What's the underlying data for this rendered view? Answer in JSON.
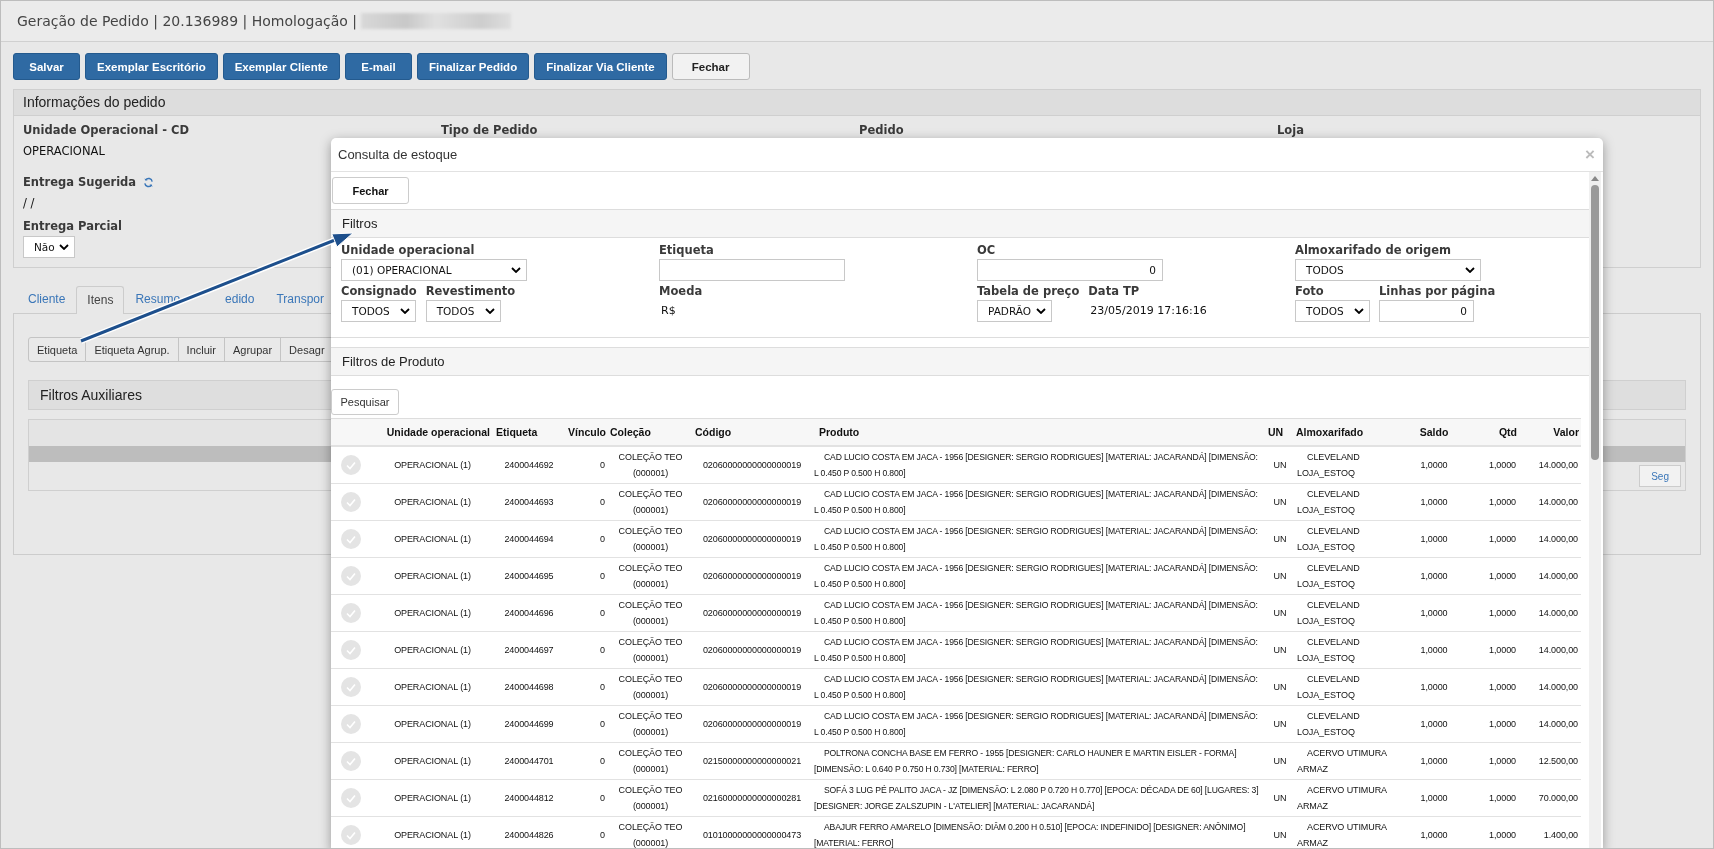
{
  "window": {
    "title": "Geração de Pedido | 20.136989 | Homologação |"
  },
  "toolbar": [
    {
      "label": "Salvar",
      "kind": "primary"
    },
    {
      "label": "Exemplar Escritório",
      "kind": "primary"
    },
    {
      "label": "Exemplar Cliente",
      "kind": "primary"
    },
    {
      "label": "E-mail",
      "kind": "primary"
    },
    {
      "label": "Finalizar Pedido",
      "kind": "primary"
    },
    {
      "label": "Finalizar Via Cliente",
      "kind": "primary"
    },
    {
      "label": "Fechar",
      "kind": "default"
    }
  ],
  "order_info": {
    "title": "Informações do pedido",
    "columns": [
      {
        "fields": [
          {
            "label": "Unidade Operacional - CD",
            "kind": "text",
            "value": "OPERACIONAL"
          },
          {
            "label": "Entrega Sugerida",
            "kind": "refresh",
            "value": "/ /"
          },
          {
            "label": "Entrega Parcial",
            "kind": "select",
            "value": "Não"
          }
        ]
      },
      {
        "fields": [
          {
            "label": "Tipo de Pedido",
            "kind": "label"
          }
        ]
      },
      {
        "fields": [
          {
            "label": "Pedido",
            "kind": "label"
          }
        ]
      },
      {
        "fields": [
          {
            "label": "Loja",
            "kind": "label"
          }
        ]
      }
    ]
  },
  "tabs": [
    {
      "label": "Cliente",
      "selected": false
    },
    {
      "label": "Itens",
      "selected": true
    },
    {
      "parts": [
        "Resumo",
        "edido"
      ],
      "selected": false
    },
    {
      "label": "Transpor",
      "selected": false
    }
  ],
  "item_actions": [
    "Etiqueta",
    "Etiqueta Agrup.",
    "Incluir",
    "Agrupar",
    "Desagr"
  ],
  "aux_filters": {
    "title": "Filtros Auxiliares"
  },
  "grid": {
    "next_button": "Seg"
  },
  "modal": {
    "title": "Consulta de estoque",
    "close": "×",
    "close_button": "Fechar",
    "filters_title": "Filtros",
    "filter_columns": [
      [
        [
          {
            "label": "Unidade operacional",
            "kind": "select",
            "value": "(01) OPERACIONAL"
          }
        ],
        [
          {
            "label": "Consignado",
            "kind": "select",
            "value": "TODOS"
          },
          {
            "label": "Revestimento",
            "kind": "select",
            "value": "TODOS"
          }
        ]
      ],
      [
        [
          {
            "label": "Etiqueta",
            "kind": "input"
          }
        ],
        [
          {
            "label": "Moeda",
            "kind": "text",
            "value": "R$"
          }
        ]
      ],
      [
        [
          {
            "label": "OC",
            "kind": "input",
            "value": "0"
          }
        ],
        [
          {
            "label": "Tabela de preço",
            "kind": "select",
            "value": "PADRÃO"
          },
          {
            "label": "Data TP",
            "kind": "text",
            "value": "23/05/2019 17:16:16"
          }
        ]
      ],
      [
        [
          {
            "label": "Almoxarifado de origem",
            "kind": "select",
            "value": "TODOS"
          }
        ],
        [
          {
            "label": "Foto",
            "kind": "select",
            "value": "TODOS"
          },
          {
            "label": "Linhas por página",
            "kind": "input",
            "value": "0"
          }
        ]
      ]
    ],
    "product_filters_title": "Filtros de Produto",
    "search_button": "Pesquisar",
    "columns": [
      "Unidade operacional",
      "Etiqueta",
      "Vínculo",
      "Coleção",
      "Código",
      "Produto",
      "UN",
      "Almoxarifado",
      "Saldo",
      "Qtd",
      "Valor"
    ],
    "rows": [
      {
        "selected": false,
        "cells": [
          "OPERACIONAL (1)",
          "2400044692",
          "0",
          "COLEÇÃO TEO (000001)",
          "02060000000000000019",
          "CAD LUCIO COSTA EM JACA - 1956 [DESIGNER: SERGIO RODRIGUES] [MATERIAL: JACARANDÁ] [DIMENSÃO: L 0.450 P 0.500 H 0.800]",
          "UN",
          "CLEVELAND LOJA_ESTOQ",
          "1,0000",
          "1,0000",
          "14.000,00"
        ]
      },
      {
        "selected": false,
        "cells": [
          "OPERACIONAL (1)",
          "2400044693",
          "0",
          "COLEÇÃO TEO (000001)",
          "02060000000000000019",
          "CAD LUCIO COSTA EM JACA - 1956 [DESIGNER: SERGIO RODRIGUES] [MATERIAL: JACARANDÁ] [DIMENSÃO: L 0.450 P 0.500 H 0.800]",
          "UN",
          "CLEVELAND LOJA_ESTOQ",
          "1,0000",
          "1,0000",
          "14.000,00"
        ]
      },
      {
        "selected": false,
        "cells": [
          "OPERACIONAL (1)",
          "2400044694",
          "0",
          "COLEÇÃO TEO (000001)",
          "02060000000000000019",
          "CAD LUCIO COSTA EM JACA - 1956 [DESIGNER: SERGIO RODRIGUES] [MATERIAL: JACARANDÁ] [DIMENSÃO: L 0.450 P 0.500 H 0.800]",
          "UN",
          "CLEVELAND LOJA_ESTOQ",
          "1,0000",
          "1,0000",
          "14.000,00"
        ]
      },
      {
        "selected": false,
        "cells": [
          "OPERACIONAL (1)",
          "2400044695",
          "0",
          "COLEÇÃO TEO (000001)",
          "02060000000000000019",
          "CAD LUCIO COSTA EM JACA - 1956 [DESIGNER: SERGIO RODRIGUES] [MATERIAL: JACARANDÁ] [DIMENSÃO: L 0.450 P 0.500 H 0.800]",
          "UN",
          "CLEVELAND LOJA_ESTOQ",
          "1,0000",
          "1,0000",
          "14.000,00"
        ]
      },
      {
        "selected": false,
        "cells": [
          "OPERACIONAL (1)",
          "2400044696",
          "0",
          "COLEÇÃO TEO (000001)",
          "02060000000000000019",
          "CAD LUCIO COSTA EM JACA - 1956 [DESIGNER: SERGIO RODRIGUES] [MATERIAL: JACARANDÁ] [DIMENSÃO: L 0.450 P 0.500 H 0.800]",
          "UN",
          "CLEVELAND LOJA_ESTOQ",
          "1,0000",
          "1,0000",
          "14.000,00"
        ]
      },
      {
        "selected": false,
        "cells": [
          "OPERACIONAL (1)",
          "2400044697",
          "0",
          "COLEÇÃO TEO (000001)",
          "02060000000000000019",
          "CAD LUCIO COSTA EM JACA - 1956 [DESIGNER: SERGIO RODRIGUES] [MATERIAL: JACARANDÁ] [DIMENSÃO: L 0.450 P 0.500 H 0.800]",
          "UN",
          "CLEVELAND LOJA_ESTOQ",
          "1,0000",
          "1,0000",
          "14.000,00"
        ]
      },
      {
        "selected": false,
        "cells": [
          "OPERACIONAL (1)",
          "2400044698",
          "0",
          "COLEÇÃO TEO (000001)",
          "02060000000000000019",
          "CAD LUCIO COSTA EM JACA - 1956 [DESIGNER: SERGIO RODRIGUES] [MATERIAL: JACARANDÁ] [DIMENSÃO: L 0.450 P 0.500 H 0.800]",
          "UN",
          "CLEVELAND LOJA_ESTOQ",
          "1,0000",
          "1,0000",
          "14.000,00"
        ]
      },
      {
        "selected": false,
        "cells": [
          "OPERACIONAL (1)",
          "2400044699",
          "0",
          "COLEÇÃO TEO (000001)",
          "02060000000000000019",
          "CAD LUCIO COSTA EM JACA - 1956 [DESIGNER: SERGIO RODRIGUES] [MATERIAL: JACARANDÁ] [DIMENSÃO: L 0.450 P 0.500 H 0.800]",
          "UN",
          "CLEVELAND LOJA_ESTOQ",
          "1,0000",
          "1,0000",
          "14.000,00"
        ]
      },
      {
        "selected": false,
        "cells": [
          "OPERACIONAL (1)",
          "2400044701",
          "0",
          "COLEÇÃO TEO (000001)",
          "02150000000000000021",
          "POLTRONA CONCHA BASE EM FERRO - 1955 [DESIGNER: CARLO HAUNER E MARTIN EISLER - FORMA] [DIMENSÃO: L 0.640 P 0.750 H 0.730] [MATERIAL: FERRO]",
          "UN",
          "ACERVO UTIMURA ARMAZ",
          "1,0000",
          "1,0000",
          "12.500,00"
        ]
      },
      {
        "selected": false,
        "cells": [
          "OPERACIONAL (1)",
          "2400044812",
          "0",
          "COLEÇÃO TEO (000001)",
          "02160000000000000281",
          "SOFÁ 3 LUG PÉ PALITO JACA - JZ [DIMENSÃO: L 2.080 P 0.720 H 0.770] [EPOCA: DÉCADA DE 60] [LUGARES: 3] [DESIGNER: JORGE ZALSZUPIN - L'ATELIER] [MATERIAL: JACARANDÁ]",
          "UN",
          "ACERVO UTIMURA ARMAZ",
          "1,0000",
          "1,0000",
          "70.000,00"
        ]
      },
      {
        "selected": false,
        "cells": [
          "OPERACIONAL (1)",
          "2400044826",
          "0",
          "COLEÇÃO TEO (000001)",
          "01010000000000000473",
          "ABAJUR FERRO AMARELO [DIMENSÃO: DIÂM 0.200 H 0.510] [EPOCA: INDEFINIDO] [DESIGNER: ANÔNIMO] [MATERIAL: FERRO]",
          "UN",
          "ACERVO UTIMURA ARMAZ",
          "1,0000",
          "1,0000",
          "1.400,00"
        ]
      }
    ]
  }
}
